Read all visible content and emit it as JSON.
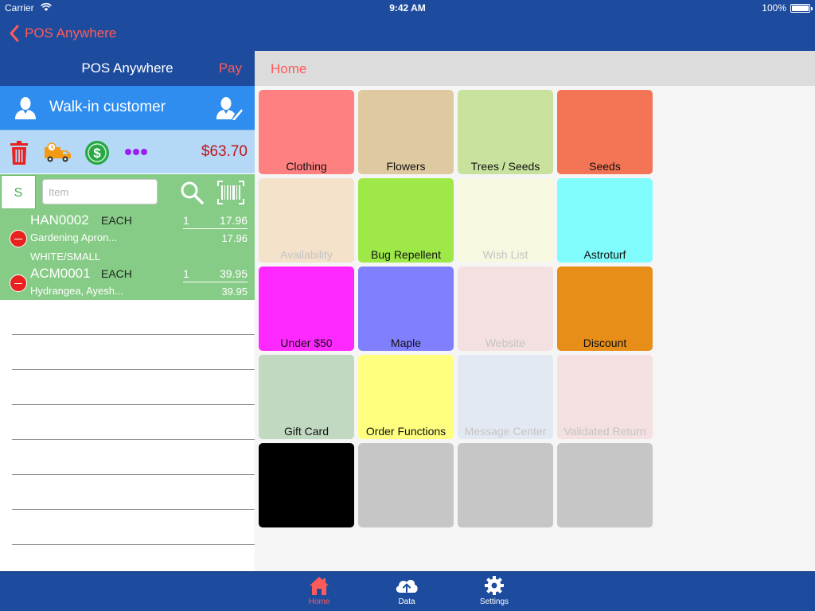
{
  "status_bar": {
    "carrier": "Carrier",
    "time": "9:42 AM",
    "battery": "100%"
  },
  "nav": {
    "back_label": "POS Anywhere"
  },
  "left_panel": {
    "title": "POS Anywhere",
    "pay_label": "Pay",
    "customer_name": "Walk-in customer",
    "total": "$63.70",
    "s_button_label": "S",
    "item_placeholder": "Item",
    "order_lines": [
      {
        "sku": "HAN0002",
        "uom": "EACH",
        "qty": "1",
        "price": "17.96",
        "description": "Gardening Apron...",
        "extended": "17.96",
        "variant": "WHITE/SMALL"
      },
      {
        "sku": "ACM0001",
        "uom": "EACH",
        "qty": "1",
        "price": "39.95",
        "description": "Hydrangea, Ayesh...",
        "extended": "39.95"
      }
    ]
  },
  "right_panel": {
    "breadcrumb": "Home",
    "tiles": [
      {
        "label": "Clothing",
        "color": "#ff8080",
        "enabled": true
      },
      {
        "label": "Flowers",
        "color": "#dfc9a0",
        "enabled": true
      },
      {
        "label": "Trees / Seeds",
        "color": "#c8e29e",
        "enabled": true
      },
      {
        "label": "Seeds",
        "color": "#f47555",
        "enabled": true
      },
      {
        "label": "Availability",
        "color": "#f4e2cb",
        "enabled": false
      },
      {
        "label": "Bug Repellent",
        "color": "#9ee948",
        "enabled": true
      },
      {
        "label": "Wish List",
        "color": "#f8f8e0",
        "enabled": false
      },
      {
        "label": "Astroturf",
        "color": "#80fcfc",
        "enabled": true
      },
      {
        "label": "Under $50",
        "color": "#ff28ff",
        "enabled": true
      },
      {
        "label": "Maple",
        "color": "#8080ff",
        "enabled": true
      },
      {
        "label": "Website",
        "color": "#f4e0e0",
        "enabled": false
      },
      {
        "label": "Discount",
        "color": "#e68e18",
        "enabled": true
      },
      {
        "label": "Gift Card",
        "color": "#c1d8c1",
        "enabled": true
      },
      {
        "label": "Order Functions",
        "color": "#ffff80",
        "enabled": true
      },
      {
        "label": "Message Center",
        "color": "#e3e9f2",
        "enabled": false
      },
      {
        "label": "Validated Return",
        "color": "#f4e0e0",
        "enabled": false
      },
      {
        "label": "",
        "color": "#000000",
        "enabled": true
      },
      {
        "label": "",
        "color": "#c6c6c6",
        "enabled": true
      },
      {
        "label": "",
        "color": "#c6c6c6",
        "enabled": true
      },
      {
        "label": "",
        "color": "#c6c6c6",
        "enabled": true
      }
    ]
  },
  "tab_bar": {
    "tabs": [
      {
        "label": "Home",
        "icon": "home-icon",
        "active": true
      },
      {
        "label": "Data",
        "icon": "cloud-upload-icon",
        "active": false
      },
      {
        "label": "Settings",
        "icon": "gear-icon",
        "active": false
      }
    ]
  },
  "colors": {
    "nav_blue": "#1d4c9e",
    "accent_red": "#ff5a5a",
    "customer_blue": "#2f8df0",
    "action_bar": "#b5d8f7",
    "order_green": "#86cc86",
    "total_red": "#c0141a"
  }
}
